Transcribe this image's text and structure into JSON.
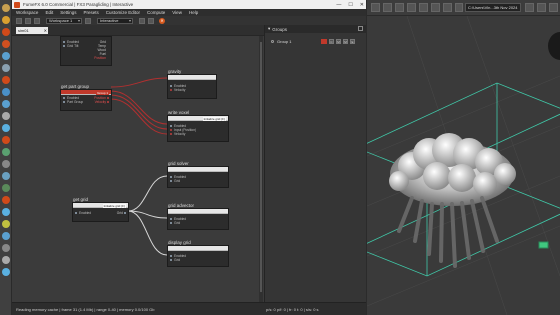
{
  "window": {
    "title": "FumeFX 6.0 Commercial | FX3 Paragliding | Interactive",
    "controls": [
      "—",
      "☐",
      "✕"
    ]
  },
  "menu": [
    "Workspace",
    "Edit",
    "Settings",
    "Presets",
    "Customize Editor",
    "Compute",
    "View",
    "Help"
  ],
  "toolbar": {
    "workspace_value": "Workspace 1",
    "mode_value": "Interactive"
  },
  "graph_tab": {
    "label": "sim01"
  },
  "nodes": {
    "top_node": {
      "ports_in": [
        "Enabled",
        "Grid Tilt"
      ],
      "ports_out": [
        "Grid",
        "Temp",
        "Wood",
        "Fuel",
        "Position"
      ]
    },
    "get_part_group": {
      "title": "get part group",
      "field": "Group 1",
      "ports_in": [
        "Enabled",
        "Part Group"
      ],
      "ports_out": [
        "Position",
        "Velocity"
      ]
    },
    "gravity": {
      "title": "gravity",
      "ports_in": [
        "Enabled",
        "Velocity"
      ]
    },
    "write_voxel": {
      "title": "write voxel",
      "field": "Initialize grid (F)",
      "ports_in": [
        "Enabled",
        "Input (Position)",
        "Velocity"
      ]
    },
    "grid_solver": {
      "title": "grid solver",
      "ports_in": [
        "Enabled",
        "Grid"
      ]
    },
    "get_grid": {
      "title": "get grid",
      "field": "Initialize grid (F)",
      "ports_in": [
        "Enabled"
      ],
      "ports_out": [
        "Grid"
      ]
    },
    "grid_advector": {
      "title": "grid advector",
      "ports_in": [
        "Enabled",
        "Grid"
      ]
    },
    "display_grid": {
      "title": "display grid",
      "ports_in": [
        "Enabled",
        "Grid"
      ]
    }
  },
  "groups_panel": {
    "title": "Groups",
    "group_name": "Group 1",
    "group_color": "#c0392b",
    "buttons": [
      "C",
      "M",
      "M",
      "E"
    ]
  },
  "status": {
    "left": "Reading memory cache | frame 31 (1.4 Mb) | range 0-40 | memory 0.0/100 Gb",
    "right": "p/s: 0 p/f: 0 | fr: 0  t: 0 | s/s: 0 s"
  },
  "viewport": {
    "path": "C:\\Users\\Vin...3th Nov 2024"
  },
  "colors": {
    "accent": "#d75a1e",
    "red_wire": "#b03030",
    "white_wire": "#d8d8d8",
    "bounds_box": "#40c8a8"
  }
}
